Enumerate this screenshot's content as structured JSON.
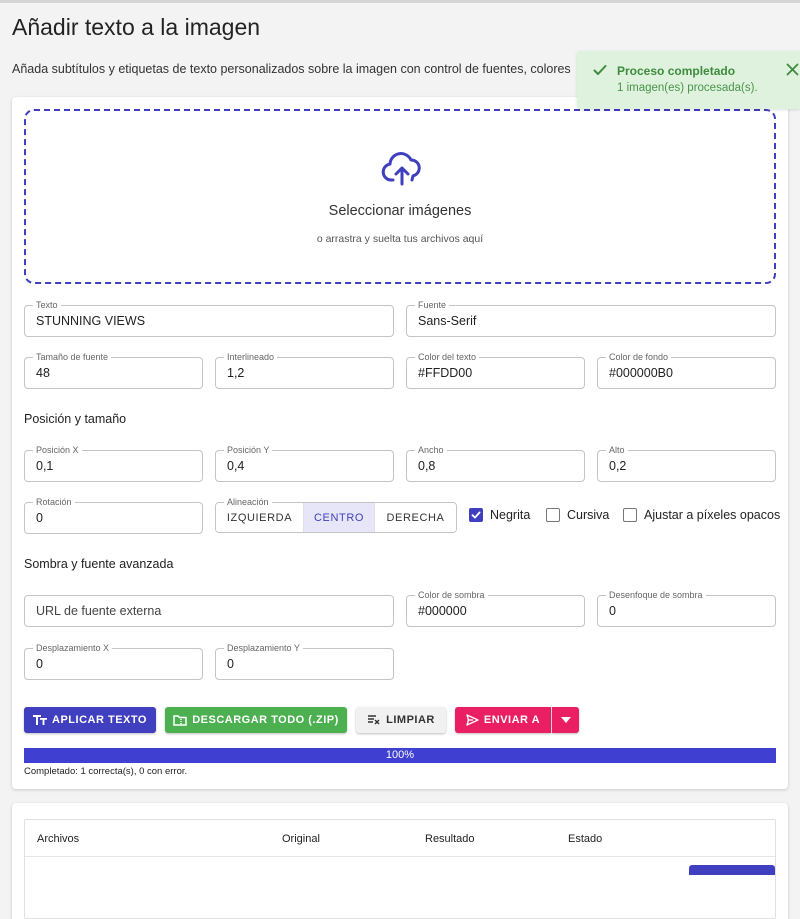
{
  "header": {
    "title": "Añadir texto a la imagen",
    "subtitle": "Añada subtítulos y etiquetas de texto personalizados sobre la imagen con control de fuentes, colores"
  },
  "toast": {
    "title": "Proceso completado",
    "message": "1 imagen(es) procesada(s).",
    "accent": "#3d8b3d"
  },
  "dropzone": {
    "icon": "cloud-upload-icon",
    "title": "Seleccionar imágenes",
    "hint": "o arrastra y suelta tus archivos aquí"
  },
  "fields": {
    "text": {
      "label": "Texto",
      "value": "STUNNING VIEWS"
    },
    "font": {
      "label": "Fuente",
      "value": "Sans-Serif"
    },
    "font_size": {
      "label": "Tamaño de fuente",
      "value": "48"
    },
    "line_height": {
      "label": "Interlineado",
      "value": "1,2"
    },
    "text_color": {
      "label": "Color del texto",
      "value": "#FFDD00"
    },
    "bg_color": {
      "label": "Color de fondo",
      "value": "#000000B0"
    },
    "pos_x": {
      "label": "Posición X",
      "value": "0,1"
    },
    "pos_y": {
      "label": "Posición Y",
      "value": "0,4"
    },
    "width": {
      "label": "Ancho",
      "value": "0,8"
    },
    "height": {
      "label": "Alto",
      "value": "0,2"
    },
    "rotation": {
      "label": "Rotación",
      "value": "0"
    },
    "font_url": {
      "placeholder": "URL de fuente externa",
      "value": ""
    },
    "shadow_color": {
      "label": "Color de sombra",
      "value": "#000000"
    },
    "shadow_blur": {
      "label": "Desenfoque de sombra",
      "value": "0"
    },
    "offset_x": {
      "label": "Desplazamiento X",
      "value": "0"
    },
    "offset_y": {
      "label": "Desplazamiento Y",
      "value": "0"
    }
  },
  "sections": {
    "position_size": "Posición y tamaño",
    "shadow_advanced": "Sombra y fuente avanzada"
  },
  "alignment": {
    "label": "Alineación",
    "options": [
      "IZQUIERDA",
      "CENTRO",
      "DERECHA"
    ],
    "selected": "CENTRO"
  },
  "checkboxes": {
    "bold": {
      "label": "Negrita",
      "checked": true
    },
    "italic": {
      "label": "Cursiva",
      "checked": false
    },
    "fit_opaque": {
      "label": "Ajustar a píxeles opacos",
      "checked": false
    }
  },
  "buttons": {
    "apply": "APLICAR TEXTO",
    "download_zip": "DESCARGAR TODO (.ZIP)",
    "clear": "LIMPIAR",
    "send_to": "ENVIAR A"
  },
  "progress": {
    "percent": 100,
    "label": "100%",
    "status": "Completado: 1 correcta(s), 0 con error."
  },
  "table": {
    "columns": [
      "Archivos",
      "Original",
      "Resultado",
      "Estado"
    ]
  },
  "colors": {
    "primary": "#3f3fbf",
    "success": "#4caf50",
    "accent": "#e91e63"
  }
}
